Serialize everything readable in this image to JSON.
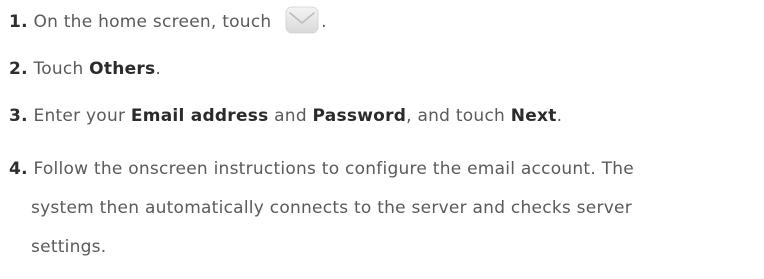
{
  "steps": [
    {
      "number": "1.",
      "text_before": "On the home screen, touch",
      "icon": "email-app-icon",
      "text_after": "."
    },
    {
      "number": "2.",
      "text_before": "Touch ",
      "bold1": "Others",
      "text_after": "."
    },
    {
      "number": "3.",
      "text_before": "Enter your ",
      "bold1": "Email address",
      "text_mid1": " and ",
      "bold2": "Password",
      "text_mid2": ", and touch ",
      "bold3": "Next",
      "text_after": "."
    },
    {
      "number": "4.",
      "line1": "Follow the onscreen instructions to configure the email account. The",
      "line2": "system then automatically connects to the server and checks server",
      "line3": "settings."
    }
  ],
  "colors": {
    "text": "#5a5a5a",
    "emphasis": "#2b2b2b",
    "icon_fill": "#e6e6e6"
  }
}
